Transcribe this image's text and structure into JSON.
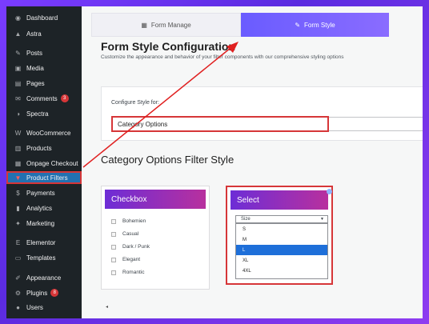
{
  "sidebar": {
    "items": [
      {
        "label": "Dashboard",
        "icon": "dashboard-icon",
        "glyph": "◉"
      },
      {
        "label": "Astra",
        "icon": "astra-icon",
        "glyph": "▲"
      },
      {
        "label": "Posts",
        "icon": "pin-icon",
        "glyph": "✎"
      },
      {
        "label": "Media",
        "icon": "media-icon",
        "glyph": "▣"
      },
      {
        "label": "Pages",
        "icon": "pages-icon",
        "glyph": "▤"
      },
      {
        "label": "Comments",
        "icon": "comments-icon",
        "glyph": "✉",
        "badge": "3"
      },
      {
        "label": "Spectra",
        "icon": "spectra-icon",
        "glyph": "◑"
      },
      {
        "label": "WooCommerce",
        "icon": "woocommerce-icon",
        "glyph": "W"
      },
      {
        "label": "Products",
        "icon": "products-icon",
        "glyph": "▥"
      },
      {
        "label": "Onpage Checkout",
        "icon": "checkout-icon",
        "glyph": "▦"
      },
      {
        "label": "Product Filters",
        "icon": "filter-icon",
        "glyph": "▼",
        "active": true
      },
      {
        "label": "Payments",
        "icon": "payments-icon",
        "glyph": "$"
      },
      {
        "label": "Analytics",
        "icon": "analytics-icon",
        "glyph": "▮"
      },
      {
        "label": "Marketing",
        "icon": "marketing-icon",
        "glyph": "✦"
      },
      {
        "label": "Elementor",
        "icon": "elementor-icon",
        "glyph": "E"
      },
      {
        "label": "Templates",
        "icon": "templates-icon",
        "glyph": "▭"
      },
      {
        "label": "Appearance",
        "icon": "appearance-icon",
        "glyph": "✐"
      },
      {
        "label": "Plugins",
        "icon": "plugins-icon",
        "glyph": "⚙",
        "badge": "8"
      },
      {
        "label": "Users",
        "icon": "users-icon",
        "glyph": "●"
      }
    ]
  },
  "tabs": [
    {
      "label": "Form Manage",
      "icon": "grid-icon",
      "glyph": "▦",
      "active": false
    },
    {
      "label": "Form Style",
      "icon": "brush-icon",
      "glyph": "✎",
      "active": true
    }
  ],
  "header": {
    "title": "Form Style Configuration",
    "subtitle": "Customize the appearance and behavior of your filter components with our comprehensive styling options"
  },
  "config": {
    "label": "Configure Style for:",
    "selected": "Category Options"
  },
  "section_title": "Category Options Filter Style",
  "checkbox_card": {
    "title": "Checkbox",
    "items": [
      "Bohemien",
      "Casual",
      "Dark / Punk",
      "Elegant",
      "Romantic"
    ]
  },
  "select_card": {
    "title": "Select",
    "current": "Size",
    "options": [
      "S",
      "M",
      "L",
      "XL",
      "4XL"
    ],
    "selected_index": 2
  },
  "scroll_left_glyph": "◂",
  "colors": {
    "sidebar_bg": "#1d2327",
    "active_item": "#2271b1",
    "highlight_red": "#d63638",
    "tab_gradient_start": "#6a5cff",
    "card_gradient_start": "#6d2dd6",
    "card_gradient_end": "#b8309e"
  }
}
